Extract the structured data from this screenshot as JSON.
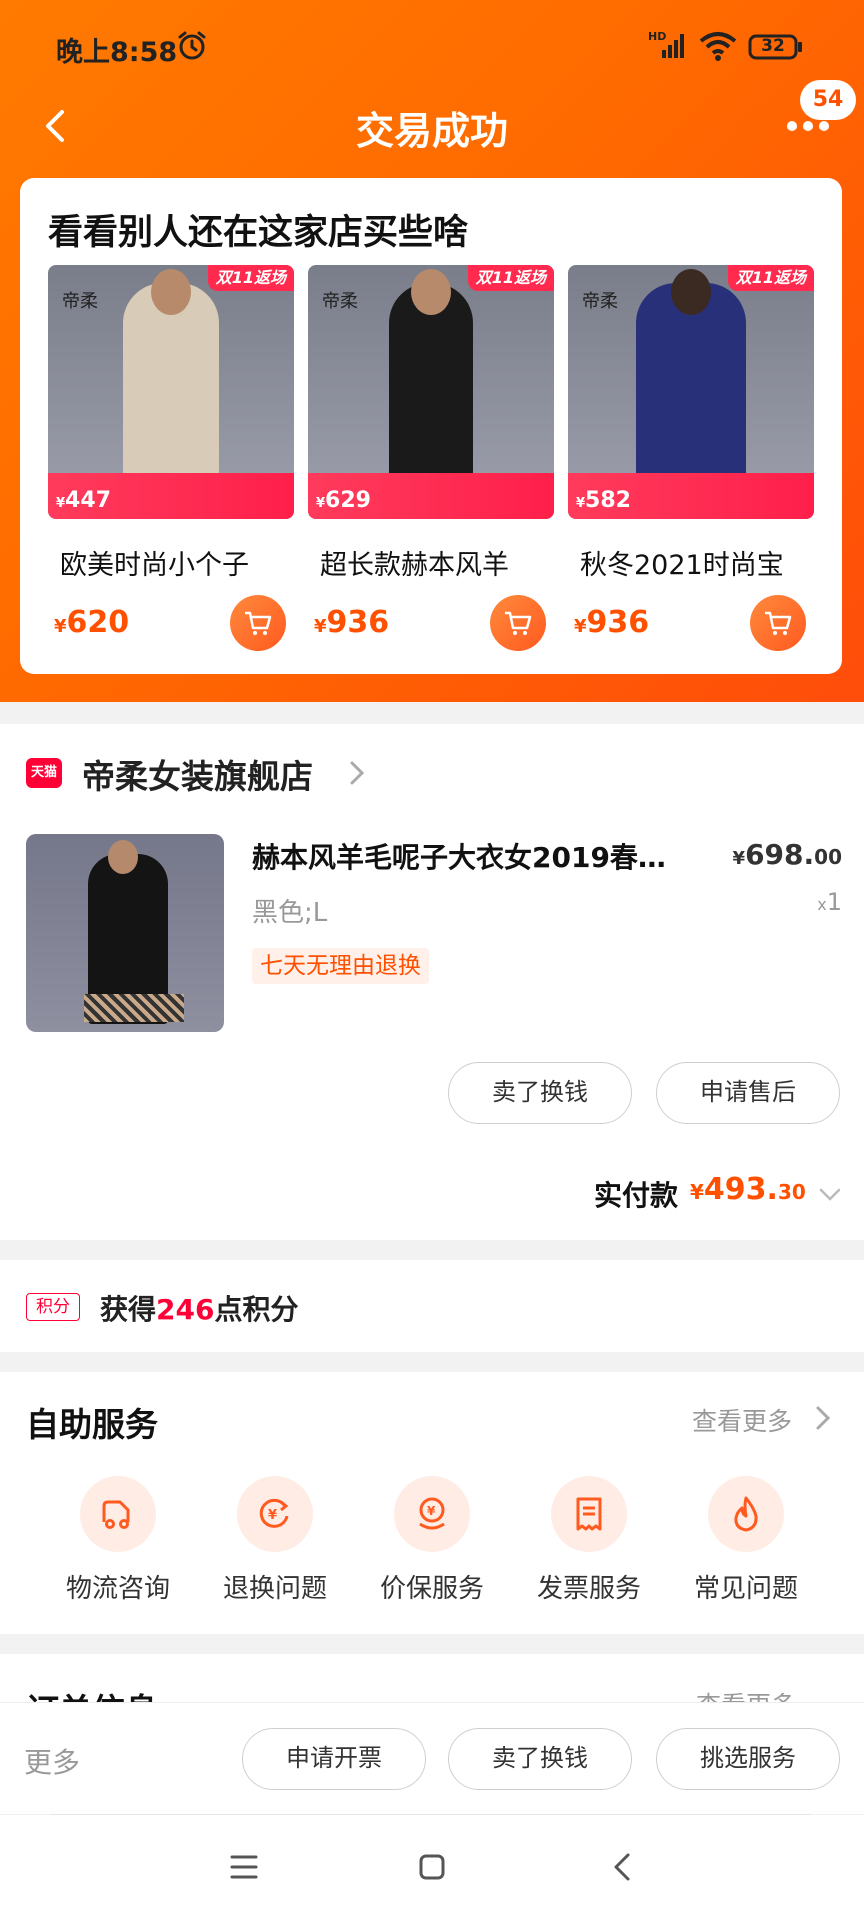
{
  "status_bar": {
    "time": "晚上8:58",
    "network": "HD",
    "battery": "32"
  },
  "header": {
    "title": "交易成功",
    "message_count": "54"
  },
  "recommend": {
    "title": "看看别人还在这家店买些啥",
    "items": [
      {
        "name": "欧美时尚小个子",
        "price": "620",
        "promo_tag": "双11返场",
        "brand": "帝柔",
        "strip_price": "447",
        "coat_color": "#d8cbb8"
      },
      {
        "name": "超长款赫本风羊",
        "price": "936",
        "promo_tag": "双11返场",
        "brand": "帝柔",
        "strip_price": "629",
        "coat_color": "#1a1a1a"
      },
      {
        "name": "秋冬2021时尚宝",
        "price": "936",
        "promo_tag": "双11返场",
        "brand": "帝柔",
        "strip_price": "582",
        "coat_color": "#28307a"
      }
    ],
    "currency": "¥"
  },
  "order": {
    "platform_badge": "天猫",
    "store_name": "帝柔女装旗舰店",
    "product_title": "赫本风羊毛呢子大衣女2019春…",
    "product_price_main": "698.",
    "product_price_cents": "00",
    "sku": "黑色;L",
    "qty_prefix": "x",
    "qty": "1",
    "return_tag": "七天无理由退换",
    "btn_sell": "卖了换钱",
    "btn_after_sale": "申请售后",
    "paid_label": "实付款",
    "paid_main": "493.",
    "paid_cents": "30"
  },
  "points": {
    "badge": "积分",
    "prefix": "获得",
    "value": "246",
    "suffix": "点积分"
  },
  "service": {
    "title": "自助服务",
    "view_more": "查看更多",
    "items": [
      {
        "label": "物流咨询",
        "icon": "truck-icon"
      },
      {
        "label": "退换问题",
        "icon": "return-money-icon"
      },
      {
        "label": "价保服务",
        "icon": "price-protect-icon"
      },
      {
        "label": "发票服务",
        "icon": "receipt-icon"
      },
      {
        "label": "常见问题",
        "icon": "flame-icon"
      }
    ]
  },
  "order_info": {
    "title": "订单信息",
    "view_more": "查看更多"
  },
  "bottom_bar": {
    "more": "更多",
    "btn_invoice": "申请开票",
    "btn_sell": "卖了换钱",
    "btn_select": "挑选服务"
  },
  "colors": {
    "accent": "#ff5000",
    "tmall": "#ff0036",
    "header_gradient_start": "#ff7a00"
  }
}
